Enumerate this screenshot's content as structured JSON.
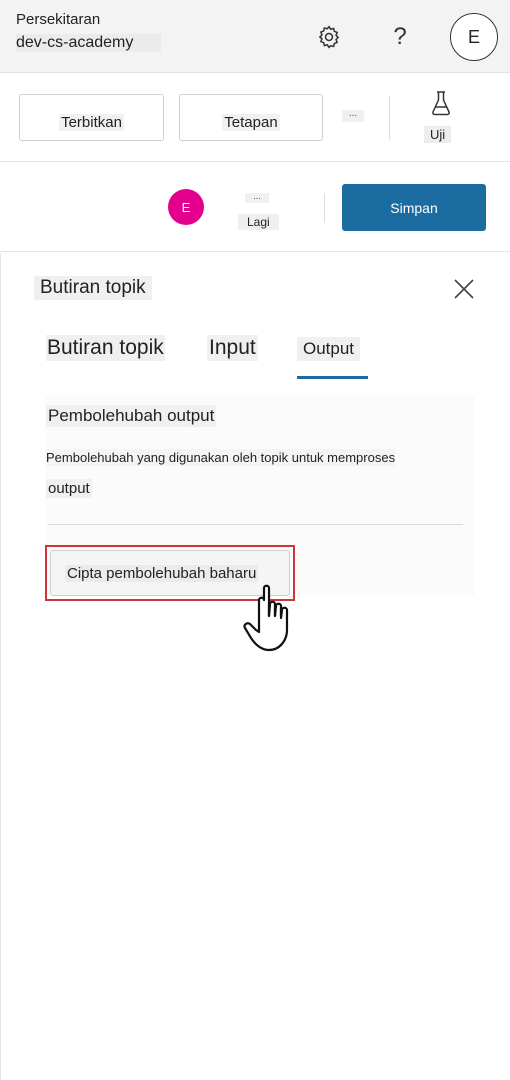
{
  "header": {
    "env_label": "Persekitaran",
    "env_name": "dev-cs-academy",
    "help_glyph": "?",
    "avatar_initial": "E",
    "icons": [
      "gear-icon",
      "help-icon"
    ]
  },
  "toolbar": {
    "publish_label": "Terbitkan",
    "settings_label": "Tetapan",
    "more_glyph": "...",
    "test_label": "Uji",
    "test_icon": "flask-icon"
  },
  "toolbar2": {
    "user_initial": "E",
    "user_color": "#e3008c",
    "more_glyph": "...",
    "more_label": "Lagi",
    "save_label": "Simpan",
    "save_color": "#1b6da1"
  },
  "panel": {
    "title": "Butiran topik",
    "close_icon": "close-icon",
    "tabs": [
      {
        "label": "Butiran topik",
        "selected": false
      },
      {
        "label": "Input",
        "selected": false
      },
      {
        "label": "Output",
        "selected": true
      }
    ],
    "section_heading": "Pembolehubah output",
    "section_desc_line1": "Pembolehubah yang digunakan oleh topik untuk memproses",
    "section_desc_line2": "output",
    "create_button_label": "Cipta pembolehubah baharu",
    "highlight_color": "#d13438"
  }
}
